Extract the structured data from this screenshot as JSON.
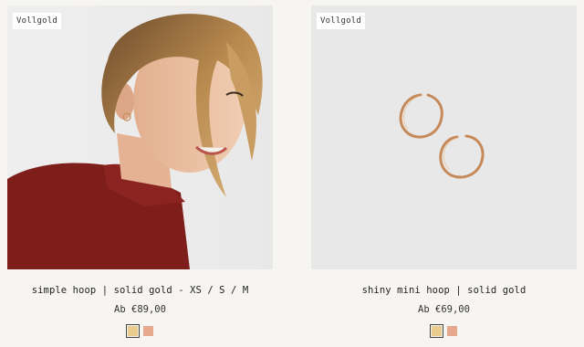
{
  "products": [
    {
      "badge": "Vollgold",
      "title": "simple hoop | solid gold - XS / S / M",
      "price": "Ab €89,00",
      "image_icon": "model-photo-icon",
      "swatches": [
        {
          "name": "yellow-gold",
          "color": "#e9cc8e",
          "selected": true
        },
        {
          "name": "rose-gold",
          "color": "#e7a98e",
          "selected": false
        }
      ]
    },
    {
      "badge": "Vollgold",
      "title": "shiny mini hoop | solid gold",
      "price": "Ab €69,00",
      "image_icon": "earrings-photo-icon",
      "swatches": [
        {
          "name": "yellow-gold",
          "color": "#e9cc8e",
          "selected": true
        },
        {
          "name": "rose-gold",
          "color": "#e7a98e",
          "selected": false
        }
      ]
    }
  ],
  "colors": {
    "background": "#f7f5f2",
    "hoop_gold": "#c68a5a"
  }
}
